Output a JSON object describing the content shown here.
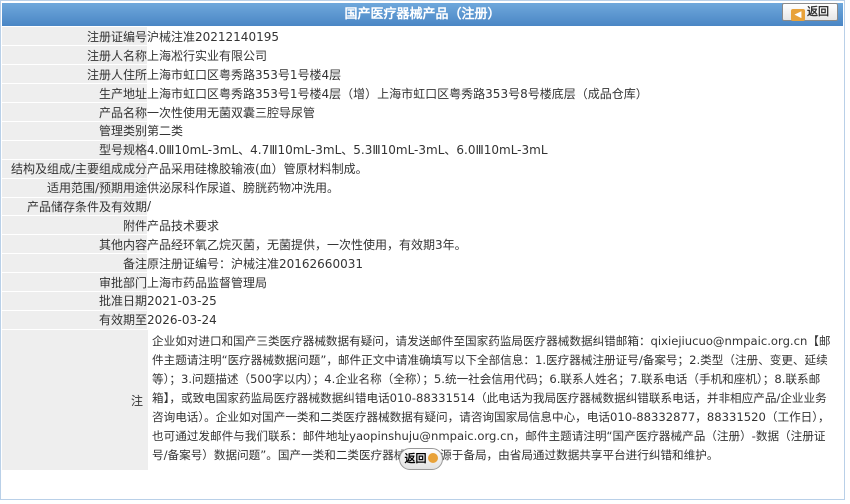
{
  "header": {
    "title": "国产医疗器械产品（注册）",
    "back_label": "返回"
  },
  "fields": [
    {
      "label": "注册证编号",
      "value": "沪械注准20212140195"
    },
    {
      "label": "注册人名称",
      "value": "上海凇行实业有限公司"
    },
    {
      "label": "注册人住所",
      "value": "上海市虹口区粤秀路353号1号楼4层"
    },
    {
      "label": "生产地址",
      "value": "上海市虹口区粤秀路353号1号楼4层（增）上海市虹口区粤秀路353号8号楼底层（成品仓库）"
    },
    {
      "label": "产品名称",
      "value": "一次性使用无菌双囊三腔导尿管"
    },
    {
      "label": "管理类别",
      "value": "第二类"
    },
    {
      "label": "型号规格",
      "value": "4.0Ⅲ10mL-3mL、4.7Ⅲ10mL-3mL、5.3Ⅲ10mL-3mL、6.0Ⅲ10mL-3mL"
    },
    {
      "label": "结构及组成/主要组成成分",
      "value": "产品采用硅橡胶输液(血）管原材料制成。"
    },
    {
      "label": "适用范围/预期用途",
      "value": "供泌尿科作尿道、膀胱药物冲洗用。"
    },
    {
      "label": "产品储存条件及有效期",
      "value": "/"
    },
    {
      "label": "附件",
      "value": "产品技术要求"
    },
    {
      "label": "其他内容",
      "value": "产品经环氧乙烷灭菌，无菌提供，一次性使用，有效期3年。"
    },
    {
      "label": "备注",
      "value": "原注册证编号：沪械注准20162660031"
    },
    {
      "label": "审批部门",
      "value": "上海市药品监督管理局"
    },
    {
      "label": "批准日期",
      "value": "2021-03-25"
    },
    {
      "label": "有效期至",
      "value": "2026-03-24"
    },
    {
      "label": "变更情况",
      "value": ""
    }
  ],
  "notes": {
    "label": "注",
    "text": "企业如对进口和国产三类医疗器械数据有疑问，请发送邮件至国家药监局医疗器械数据纠错邮箱：qixiejiucuo@nmpaic.org.cn【邮件主题请注明“医疗器械数据问题”，邮件正文中请准确填写以下全部信息：1.医疗器械注册证号/备案号；2.类型（注册、变更、延续等）；3.问题描述（500字以内）；4.企业名称（全称）；5.统一社会信用代码；6.联系人姓名；7.联系电话（手机和座机）；8.联系邮箱】，或致电国家药监局医疗器械数据纠错电话010-88331514（此电话为我局医疗器械数据纠错联系电话，并非相应产品/企业业务咨询电话）。企业如对国产一类和二类医疗器械数据有疑问，请咨询国家局信息中心，电话010-88332877，88331520（工作日），也可通过发邮件与我们联系：邮件地址yaopinshuju@nmpaic.org.cn，邮件主题请注明“国产医疗器械产品（注册）-数据（注册证号/备案号）数据问题”。国产一类和二类医疗器械数据来源于备局，由省局通过数据共享平台进行纠错和维护。"
  },
  "footer": {
    "back_label": "返回"
  },
  "colors": {
    "header_bg": "#4a86c5",
    "label_bg": "#eeeeee",
    "accent": "#e8a23a"
  }
}
